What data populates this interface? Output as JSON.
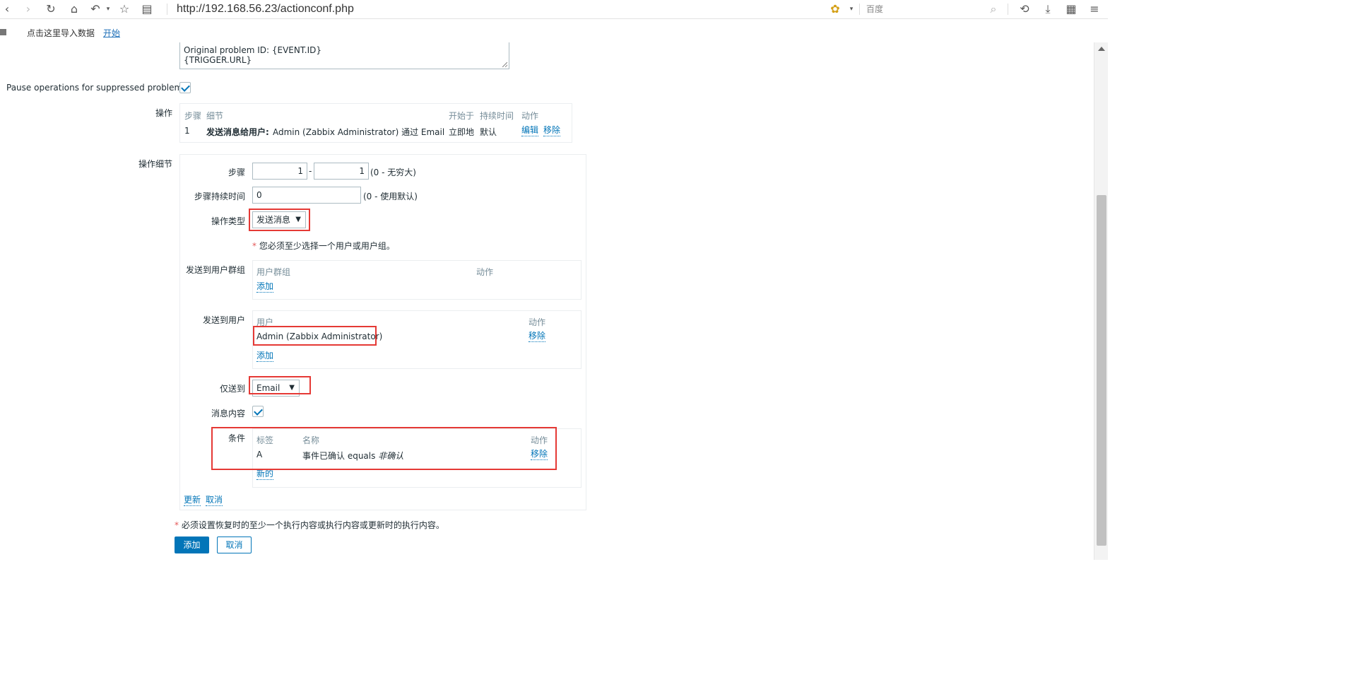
{
  "browser": {
    "url": "http://192.168.56.23/actionconf.php",
    "search_placeholder": "百度",
    "icons": [
      "back-icon",
      "forward-icon",
      "reload-icon",
      "home-icon",
      "undo-icon",
      "star-icon",
      "reader-icon",
      "bee-icon",
      "search-icon",
      "user-icon",
      "download-icon",
      "apps-icon",
      "menu-icon"
    ],
    "glyphs": {
      "back": "‹",
      "forward": "›",
      "reload": "↻",
      "home": "⌂",
      "undo": "↶",
      "undo_caret": "▾",
      "star": "☆",
      "reader": "▤",
      "bee": "✿",
      "bee_caret": "▾",
      "search": "⌕",
      "user": "⟲",
      "download": "⤓",
      "apps": "▦",
      "menu": "≡"
    },
    "bookmarks": {
      "text": "点击这里导入数据",
      "link": "开始"
    }
  },
  "message": {
    "line1": "Original problem ID: {EVENT.ID}",
    "line2": "{TRIGGER.URL}"
  },
  "pause": {
    "label": "Pause operations for suppressed problems",
    "checked": true
  },
  "operations": {
    "label": "操作",
    "headers": {
      "step": "步骤",
      "details": "细节",
      "start_in": "开始于",
      "duration": "持续时间",
      "action": "动作"
    },
    "row": {
      "step": "1",
      "details_bold": "发送消息给用户:",
      "details_rest": "Admin (Zabbix Administrator) 通过 Email",
      "start_in": "立即地",
      "duration": "默认",
      "edit": "编辑",
      "remove": "移除"
    }
  },
  "op_details": {
    "label": "操作细节",
    "steps": {
      "label": "步骤",
      "from": "1",
      "dash": "-",
      "to": "1",
      "hint": "(0 - 无穷大)"
    },
    "step_duration": {
      "label": "步骤持续时间",
      "value": "0",
      "hint": "(0 - 使用默认)"
    },
    "op_type": {
      "label": "操作类型",
      "value": "发送消息",
      "caret": "▼"
    },
    "warning": {
      "asterisk": "*",
      "text": "您必须至少选择一个用户或用户组。"
    },
    "user_groups": {
      "label": "发送到用户群组",
      "header_group": "用户群组",
      "header_action": "动作",
      "add": "添加"
    },
    "users": {
      "label": "发送到用户",
      "header_user": "用户",
      "header_action": "动作",
      "user": "Admin (Zabbix Administrator)",
      "remove": "移除",
      "add": "添加"
    },
    "send_only_to": {
      "label": "仅送到",
      "value": "Email",
      "caret": "▼"
    },
    "default_message": {
      "label": "消息内容",
      "checked": true
    },
    "conditions": {
      "label": "条件",
      "header_label": "标签",
      "header_name": "名称",
      "header_action": "动作",
      "row_label": "A",
      "row_name": "事件已确认 equals",
      "row_value": "非确认",
      "remove": "移除",
      "new": "新的"
    },
    "update": "更新",
    "cancel": "取消"
  },
  "footer": {
    "asterisk": "*",
    "note": "必须设置恢复时的至少一个执行内容或执行内容或更新时的执行内容。",
    "add_button": "添加",
    "cancel_button": "取消"
  },
  "colors": {
    "link": "#0275b8",
    "annotation": "#e53935",
    "header_text": "#768d99"
  }
}
